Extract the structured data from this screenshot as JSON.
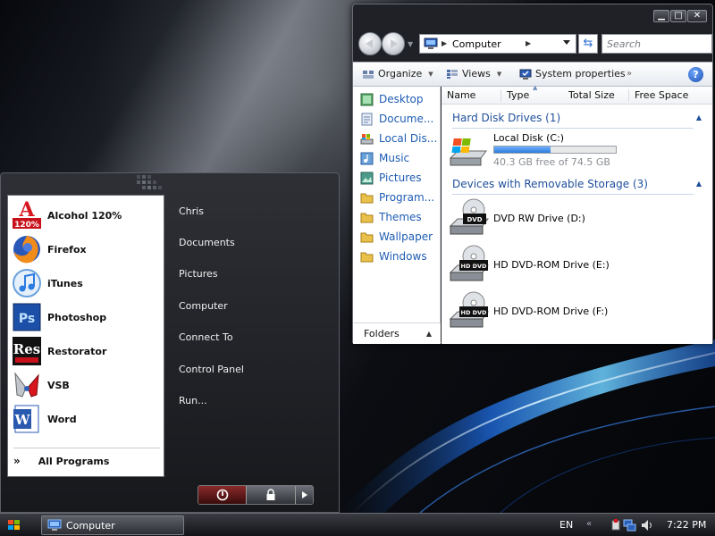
{
  "explorer": {
    "address": "Computer",
    "search_placeholder": "Search",
    "toolbar": {
      "organize": "Organize",
      "views": "Views",
      "system_properties": "System properties",
      "more": "»"
    },
    "window_controls": {
      "minimize": "▁",
      "maximize": "□",
      "close": "✕"
    },
    "navigation": [
      {
        "label": "Desktop",
        "icon": "desktop-icon"
      },
      {
        "label": "Docume...",
        "icon": "documents-icon"
      },
      {
        "label": "Local Dis...",
        "icon": "local-disk-icon"
      },
      {
        "label": "Music",
        "icon": "music-icon"
      },
      {
        "label": "Pictures",
        "icon": "pictures-icon"
      },
      {
        "label": "Program...",
        "icon": "folder-icon"
      },
      {
        "label": "Themes",
        "icon": "folder-icon"
      },
      {
        "label": "Wallpaper",
        "icon": "folder-icon"
      },
      {
        "label": "Windows",
        "icon": "folder-icon"
      }
    ],
    "folders_label": "Folders",
    "columns": [
      "Name",
      "Type",
      "Total Size",
      "Free Space"
    ],
    "groups": {
      "hard_disk": "Hard Disk Drives (1)",
      "removable": "Devices with Removable Storage (3)"
    },
    "drives": {
      "local": {
        "name": "Local Disk (C:)",
        "free": "40.3 GB free of 74.5 GB",
        "used_fraction": 0.46
      },
      "d": {
        "name": "DVD RW Drive (D:)",
        "badge": "DVD"
      },
      "e": {
        "name": "HD DVD-ROM Drive (E:)",
        "badge": "HD DVD"
      },
      "f": {
        "name": "HD DVD-ROM Drive (F:)",
        "badge": "HD DVD"
      }
    }
  },
  "start_menu": {
    "programs": [
      {
        "label": "Alcohol 120%",
        "icon": "alcohol-icon",
        "badge": "120%"
      },
      {
        "label": "Firefox",
        "icon": "firefox-icon"
      },
      {
        "label": "iTunes",
        "icon": "itunes-icon"
      },
      {
        "label": "Photoshop",
        "icon": "photoshop-icon",
        "badge": "Ps"
      },
      {
        "label": "Restorator",
        "icon": "restorator-icon",
        "badge": "Res"
      },
      {
        "label": "VSB",
        "icon": "vsb-icon"
      },
      {
        "label": "Word",
        "icon": "word-icon",
        "badge": "W"
      }
    ],
    "all_programs": "All Programs",
    "all_programs_glyph": "»",
    "places": [
      "Chris",
      "Documents",
      "Pictures",
      "Computer",
      "Connect To",
      "Control Panel",
      "Run..."
    ]
  },
  "taskbar": {
    "task": "Computer",
    "language": "EN",
    "tray_expand": "«",
    "clock": "7:22 PM"
  },
  "colors": {
    "link_blue": "#1e5cb3",
    "group_blue": "#1e4e9a",
    "power_red": "#8a2a2a",
    "capacity_blue": "#2b7ad9"
  }
}
